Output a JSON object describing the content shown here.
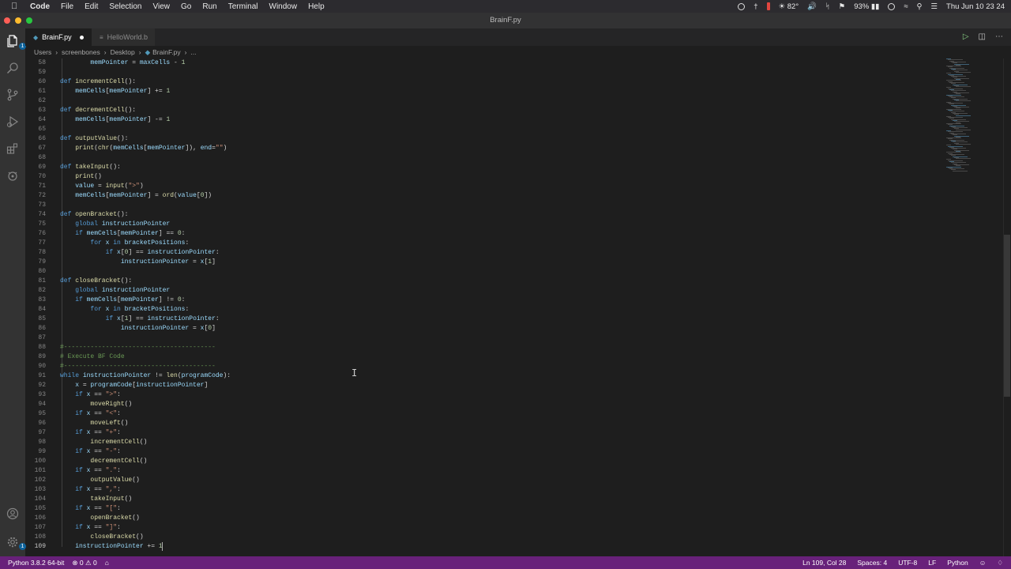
{
  "menubar": {
    "items": [
      "Code",
      "File",
      "Edit",
      "Selection",
      "View",
      "Go",
      "Run",
      "Terminal",
      "Window",
      "Help"
    ],
    "temperature": "82°",
    "battery": "93%",
    "datetime": "Thu Jun 10  23 24"
  },
  "window": {
    "title": "BrainF.py"
  },
  "tabs": [
    {
      "label": "BrainF.py",
      "icon": "python-icon",
      "dirty": true
    },
    {
      "label": "HelloWorld.b",
      "icon": "file-icon",
      "dirty": false
    }
  ],
  "activity": {
    "explorer_badge": "1"
  },
  "breadcrumb": [
    "Users",
    "screenbones",
    "Desktop",
    "BrainF.py",
    "..."
  ],
  "editor": {
    "line_numbers": [
      "58",
      "59",
      "60",
      "61",
      "62",
      "63",
      "64",
      "65",
      "66",
      "67",
      "68",
      "69",
      "70",
      "71",
      "72",
      "73",
      "74",
      "75",
      "76",
      "77",
      "78",
      "79",
      "80",
      "81",
      "82",
      "83",
      "84",
      "85",
      "86",
      "87",
      "88",
      "89",
      "90",
      "91",
      "92",
      "93",
      "94",
      "95",
      "96",
      "97",
      "98",
      "99",
      "100",
      "101",
      "102",
      "103",
      "104",
      "105",
      "106",
      "107",
      "108",
      "109"
    ],
    "current_line": "109",
    "lines": [
      [
        [
          "        ",
          ""
        ],
        [
          "memPointer",
          "vr"
        ],
        [
          " = ",
          ""
        ],
        [
          "maxCells",
          "vr"
        ],
        [
          " - ",
          ""
        ],
        [
          "1",
          "nu"
        ]
      ],
      [],
      [
        [
          "def ",
          "kw"
        ],
        [
          "incrementCell",
          "fn"
        ],
        [
          "():",
          ""
        ]
      ],
      [
        [
          "    ",
          ""
        ],
        [
          "memCells",
          "vr"
        ],
        [
          "[",
          ""
        ],
        [
          "memPointer",
          "vr"
        ],
        [
          "] += ",
          ""
        ],
        [
          "1",
          "nu"
        ]
      ],
      [],
      [
        [
          "def ",
          "kw"
        ],
        [
          "decrementCell",
          "fn"
        ],
        [
          "():",
          ""
        ]
      ],
      [
        [
          "    ",
          ""
        ],
        [
          "memCells",
          "vr"
        ],
        [
          "[",
          ""
        ],
        [
          "memPointer",
          "vr"
        ],
        [
          "] -= ",
          ""
        ],
        [
          "1",
          "nu"
        ]
      ],
      [],
      [
        [
          "def ",
          "kw"
        ],
        [
          "outputValue",
          "fn"
        ],
        [
          "():",
          ""
        ]
      ],
      [
        [
          "    ",
          ""
        ],
        [
          "print",
          "fn"
        ],
        [
          "(",
          ""
        ],
        [
          "chr",
          "fn"
        ],
        [
          "(",
          ""
        ],
        [
          "memCells",
          "vr"
        ],
        [
          "[",
          ""
        ],
        [
          "memPointer",
          "vr"
        ],
        [
          "]), ",
          ""
        ],
        [
          "end",
          "vr"
        ],
        [
          "=",
          ""
        ],
        [
          "\"\"",
          "st"
        ],
        [
          ")",
          ""
        ]
      ],
      [],
      [
        [
          "def ",
          "kw"
        ],
        [
          "takeInput",
          "fn"
        ],
        [
          "():",
          ""
        ]
      ],
      [
        [
          "    ",
          ""
        ],
        [
          "print",
          "fn"
        ],
        [
          "()",
          ""
        ]
      ],
      [
        [
          "    ",
          ""
        ],
        [
          "value",
          "vr"
        ],
        [
          " = ",
          ""
        ],
        [
          "input",
          "fn"
        ],
        [
          "(",
          ""
        ],
        [
          "\">\"",
          "st"
        ],
        [
          ")",
          ""
        ]
      ],
      [
        [
          "    ",
          ""
        ],
        [
          "memCells",
          "vr"
        ],
        [
          "[",
          ""
        ],
        [
          "memPointer",
          "vr"
        ],
        [
          "] = ",
          ""
        ],
        [
          "ord",
          "fn"
        ],
        [
          "(",
          ""
        ],
        [
          "value",
          "vr"
        ],
        [
          "[",
          ""
        ],
        [
          "0",
          "nu"
        ],
        [
          "])",
          ""
        ]
      ],
      [],
      [
        [
          "def ",
          "kw"
        ],
        [
          "openBracket",
          "fn"
        ],
        [
          "():",
          ""
        ]
      ],
      [
        [
          "    ",
          ""
        ],
        [
          "global ",
          "gl"
        ],
        [
          "instructionPointer",
          "vr"
        ]
      ],
      [
        [
          "    ",
          ""
        ],
        [
          "if ",
          "kw"
        ],
        [
          "memCells",
          "vr"
        ],
        [
          "[",
          ""
        ],
        [
          "memPointer",
          "vr"
        ],
        [
          "] == ",
          ""
        ],
        [
          "0",
          "nu"
        ],
        [
          ":",
          ""
        ]
      ],
      [
        [
          "        ",
          ""
        ],
        [
          "for ",
          "kw"
        ],
        [
          "x",
          "vr"
        ],
        [
          " in ",
          "kw"
        ],
        [
          "bracketPositions",
          "vr"
        ],
        [
          ":",
          ""
        ]
      ],
      [
        [
          "            ",
          ""
        ],
        [
          "if ",
          "kw"
        ],
        [
          "x",
          "vr"
        ],
        [
          "[",
          ""
        ],
        [
          "0",
          "nu"
        ],
        [
          "] == ",
          ""
        ],
        [
          "instructionPointer",
          "vr"
        ],
        [
          ":",
          ""
        ]
      ],
      [
        [
          "                ",
          ""
        ],
        [
          "instructionPointer",
          "vr"
        ],
        [
          " = ",
          ""
        ],
        [
          "x",
          "vr"
        ],
        [
          "[",
          ""
        ],
        [
          "1",
          "nu"
        ],
        [
          "]",
          ""
        ]
      ],
      [],
      [
        [
          "def ",
          "kw"
        ],
        [
          "closeBracket",
          "fn"
        ],
        [
          "():",
          ""
        ]
      ],
      [
        [
          "    ",
          ""
        ],
        [
          "global ",
          "gl"
        ],
        [
          "instructionPointer",
          "vr"
        ]
      ],
      [
        [
          "    ",
          ""
        ],
        [
          "if ",
          "kw"
        ],
        [
          "memCells",
          "vr"
        ],
        [
          "[",
          ""
        ],
        [
          "memPointer",
          "vr"
        ],
        [
          "] != ",
          ""
        ],
        [
          "0",
          "nu"
        ],
        [
          ":",
          ""
        ]
      ],
      [
        [
          "        ",
          ""
        ],
        [
          "for ",
          "kw"
        ],
        [
          "x",
          "vr"
        ],
        [
          " in ",
          "kw"
        ],
        [
          "bracketPositions",
          "vr"
        ],
        [
          ":",
          ""
        ]
      ],
      [
        [
          "            ",
          ""
        ],
        [
          "if ",
          "kw"
        ],
        [
          "x",
          "vr"
        ],
        [
          "[",
          ""
        ],
        [
          "1",
          "nu"
        ],
        [
          "] == ",
          ""
        ],
        [
          "instructionPointer",
          "vr"
        ],
        [
          ":",
          ""
        ]
      ],
      [
        [
          "                ",
          ""
        ],
        [
          "instructionPointer",
          "vr"
        ],
        [
          " = ",
          ""
        ],
        [
          "x",
          "vr"
        ],
        [
          "[",
          ""
        ],
        [
          "0",
          "nu"
        ],
        [
          "]",
          ""
        ]
      ],
      [],
      [
        [
          "#----------------------------------------",
          "cm"
        ]
      ],
      [
        [
          "# Execute BF Code",
          "cm"
        ]
      ],
      [
        [
          "#----------------------------------------",
          "cm"
        ]
      ],
      [
        [
          "while ",
          "kw"
        ],
        [
          "instructionPointer",
          "vr"
        ],
        [
          " != ",
          ""
        ],
        [
          "len",
          "fn"
        ],
        [
          "(",
          ""
        ],
        [
          "programCode",
          "vr"
        ],
        [
          "):",
          ""
        ]
      ],
      [
        [
          "    ",
          ""
        ],
        [
          "x",
          "vr"
        ],
        [
          " = ",
          ""
        ],
        [
          "programCode",
          "vr"
        ],
        [
          "[",
          ""
        ],
        [
          "instructionPointer",
          "vr"
        ],
        [
          "]",
          ""
        ]
      ],
      [
        [
          "    ",
          ""
        ],
        [
          "if ",
          "kw"
        ],
        [
          "x",
          "vr"
        ],
        [
          " == ",
          ""
        ],
        [
          "\">\"",
          "st"
        ],
        [
          ":",
          ""
        ]
      ],
      [
        [
          "        ",
          ""
        ],
        [
          "moveRight",
          "fn"
        ],
        [
          "()",
          ""
        ]
      ],
      [
        [
          "    ",
          ""
        ],
        [
          "if ",
          "kw"
        ],
        [
          "x",
          "vr"
        ],
        [
          " == ",
          ""
        ],
        [
          "\"<\"",
          "st"
        ],
        [
          ":",
          ""
        ]
      ],
      [
        [
          "        ",
          ""
        ],
        [
          "moveLeft",
          "fn"
        ],
        [
          "()",
          ""
        ]
      ],
      [
        [
          "    ",
          ""
        ],
        [
          "if ",
          "kw"
        ],
        [
          "x",
          "vr"
        ],
        [
          " == ",
          ""
        ],
        [
          "\"+\"",
          "st"
        ],
        [
          ":",
          ""
        ]
      ],
      [
        [
          "        ",
          ""
        ],
        [
          "incrementCell",
          "fn"
        ],
        [
          "()",
          ""
        ]
      ],
      [
        [
          "    ",
          ""
        ],
        [
          "if ",
          "kw"
        ],
        [
          "x",
          "vr"
        ],
        [
          " == ",
          ""
        ],
        [
          "\"-\"",
          "st"
        ],
        [
          ":",
          ""
        ]
      ],
      [
        [
          "        ",
          ""
        ],
        [
          "decrementCell",
          "fn"
        ],
        [
          "()",
          ""
        ]
      ],
      [
        [
          "    ",
          ""
        ],
        [
          "if ",
          "kw"
        ],
        [
          "x",
          "vr"
        ],
        [
          " == ",
          ""
        ],
        [
          "\".\"",
          "st"
        ],
        [
          ":",
          ""
        ]
      ],
      [
        [
          "        ",
          ""
        ],
        [
          "outputValue",
          "fn"
        ],
        [
          "()",
          ""
        ]
      ],
      [
        [
          "    ",
          ""
        ],
        [
          "if ",
          "kw"
        ],
        [
          "x",
          "vr"
        ],
        [
          " == ",
          ""
        ],
        [
          "\",\"",
          "st"
        ],
        [
          ":",
          ""
        ]
      ],
      [
        [
          "        ",
          ""
        ],
        [
          "takeInput",
          "fn"
        ],
        [
          "()",
          ""
        ]
      ],
      [
        [
          "    ",
          ""
        ],
        [
          "if ",
          "kw"
        ],
        [
          "x",
          "vr"
        ],
        [
          " == ",
          ""
        ],
        [
          "\"[\"",
          "st"
        ],
        [
          ":",
          ""
        ]
      ],
      [
        [
          "        ",
          ""
        ],
        [
          "openBracket",
          "fn"
        ],
        [
          "()",
          ""
        ]
      ],
      [
        [
          "    ",
          ""
        ],
        [
          "if ",
          "kw"
        ],
        [
          "x",
          "vr"
        ],
        [
          " == ",
          ""
        ],
        [
          "\"]\"",
          "st"
        ],
        [
          ":",
          ""
        ]
      ],
      [
        [
          "        ",
          ""
        ],
        [
          "closeBracket",
          "fn"
        ],
        [
          "()",
          ""
        ]
      ],
      [
        [
          "    ",
          ""
        ],
        [
          "instructionPointer",
          "vr"
        ],
        [
          " += ",
          ""
        ],
        [
          "1",
          "nu"
        ]
      ]
    ]
  },
  "statusbar": {
    "interpreter": "Python 3.8.2 64-bit",
    "errors": "0",
    "warnings": "0",
    "position": "Ln 109, Col 28",
    "spaces": "Spaces: 4",
    "encoding": "UTF-8",
    "eol": "LF",
    "language": "Python",
    "color": "#68217a"
  }
}
